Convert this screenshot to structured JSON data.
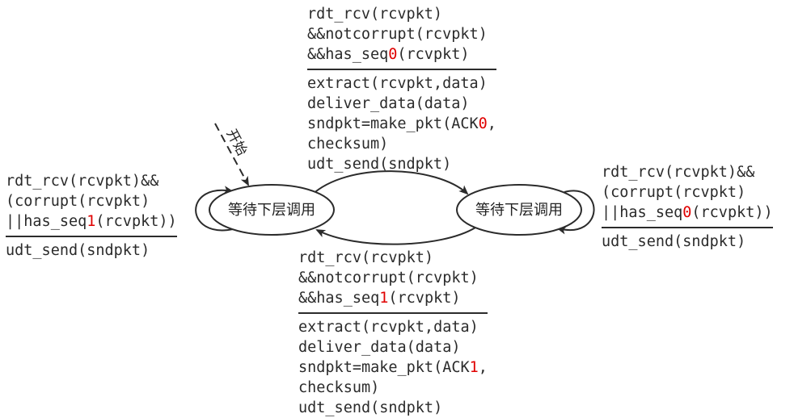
{
  "colors": {
    "text": "#2b2b2b",
    "highlight": "#e00000",
    "stroke": "#2b2b2b"
  },
  "states": [
    {
      "id": "wait_seq0",
      "label": "等待下层调用"
    },
    {
      "id": "wait_seq1",
      "label": "等待下层调用"
    }
  ],
  "start": {
    "label": "开始"
  },
  "transitions": {
    "top": {
      "condition": [
        {
          "pre": "rdt_rcv(rcvpkt)"
        },
        {
          "pre": "&&notcorrupt(rcvpkt)"
        },
        {
          "pre": "&&has_seq",
          "hl": "0",
          "post": "(rcvpkt)"
        }
      ],
      "action": [
        {
          "pre": "extract(rcvpkt,data)"
        },
        {
          "pre": "deliver_data(data)"
        },
        {
          "pre": "sndpkt=make_pkt(ACK",
          "hl": "0",
          "post": ","
        },
        {
          "pre": "checksum)"
        },
        {
          "pre": "udt_send(sndpkt)"
        }
      ]
    },
    "bottom": {
      "condition": [
        {
          "pre": "rdt_rcv(rcvpkt)"
        },
        {
          "pre": "&&notcorrupt(rcvpkt)"
        },
        {
          "pre": "&&has_seq",
          "hl": "1",
          "post": "(rcvpkt)"
        }
      ],
      "action": [
        {
          "pre": "extract(rcvpkt,data)"
        },
        {
          "pre": "deliver_data(data)"
        },
        {
          "pre": "sndpkt=make_pkt(ACK",
          "hl": "1",
          "post": ","
        },
        {
          "pre": "checksum)"
        },
        {
          "pre": "udt_send(sndpkt)"
        }
      ]
    },
    "left": {
      "condition": [
        {
          "pre": "rdt_rcv(rcvpkt)&&"
        },
        {
          "pre": "(corrupt(rcvpkt)"
        },
        {
          "pre": "||has_seq",
          "hl": "1",
          "post": "(rcvpkt))"
        }
      ],
      "action": [
        {
          "pre": "udt_send(sndpkt)"
        }
      ]
    },
    "right": {
      "condition": [
        {
          "pre": "rdt_rcv(rcvpkt)&&"
        },
        {
          "pre": "(corrupt(rcvpkt)"
        },
        {
          "pre": "||has_seq",
          "hl": "0",
          "post": "(rcvpkt))"
        }
      ],
      "action": [
        {
          "pre": "udt_send(sndpkt)"
        }
      ]
    }
  }
}
